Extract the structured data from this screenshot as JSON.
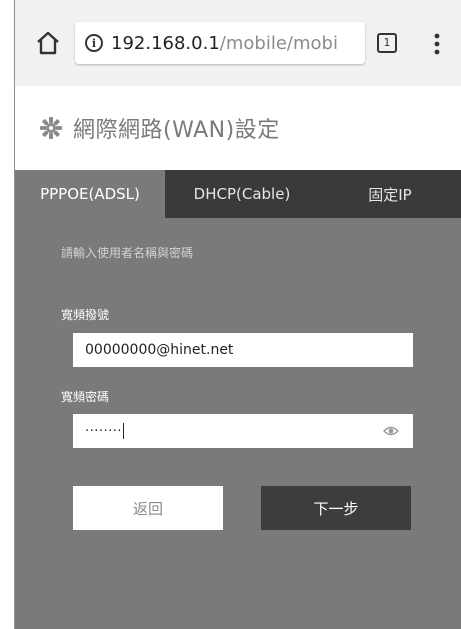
{
  "browser": {
    "url_host": "192.168.0.1",
    "url_path": "/mobile/mobi",
    "tab_count": "1",
    "info_glyph": "i"
  },
  "header": {
    "title": "網際網路(WAN)設定",
    "icon": "gear-icon"
  },
  "tabs": [
    {
      "label": "PPPOE(ADSL)",
      "active": true
    },
    {
      "label": "DHCP(Cable)",
      "active": false
    },
    {
      "label": "固定IP",
      "active": false
    }
  ],
  "form": {
    "instruction": "請輸入使用者名稱與密碼",
    "account_label": "寬頻撥號",
    "account_value": "00000000@hinet.net",
    "password_label": "寬頻密碼",
    "password_value": "········"
  },
  "buttons": {
    "back": "返回",
    "next": "下一步"
  },
  "colors": {
    "panel": "#7a7a7a",
    "tab_bar": "#3a3a3a",
    "next_button": "#3d3d3d"
  }
}
